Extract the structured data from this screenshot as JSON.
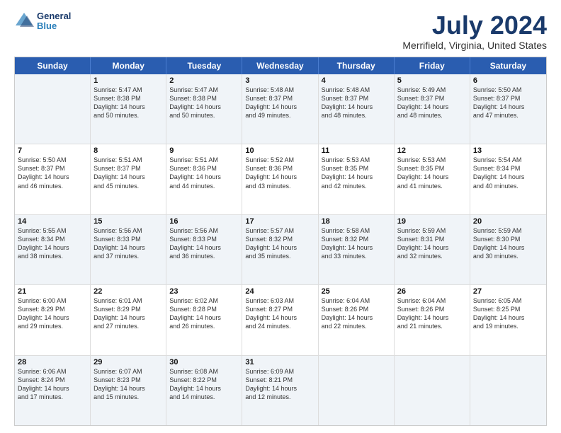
{
  "logo": {
    "line1": "General",
    "line2": "Blue"
  },
  "title": "July 2024",
  "subtitle": "Merrifield, Virginia, United States",
  "days": [
    "Sunday",
    "Monday",
    "Tuesday",
    "Wednesday",
    "Thursday",
    "Friday",
    "Saturday"
  ],
  "rows": [
    [
      {
        "day": "",
        "text": ""
      },
      {
        "day": "1",
        "text": "Sunrise: 5:47 AM\nSunset: 8:38 PM\nDaylight: 14 hours\nand 50 minutes."
      },
      {
        "day": "2",
        "text": "Sunrise: 5:47 AM\nSunset: 8:38 PM\nDaylight: 14 hours\nand 50 minutes."
      },
      {
        "day": "3",
        "text": "Sunrise: 5:48 AM\nSunset: 8:37 PM\nDaylight: 14 hours\nand 49 minutes."
      },
      {
        "day": "4",
        "text": "Sunrise: 5:48 AM\nSunset: 8:37 PM\nDaylight: 14 hours\nand 48 minutes."
      },
      {
        "day": "5",
        "text": "Sunrise: 5:49 AM\nSunset: 8:37 PM\nDaylight: 14 hours\nand 48 minutes."
      },
      {
        "day": "6",
        "text": "Sunrise: 5:50 AM\nSunset: 8:37 PM\nDaylight: 14 hours\nand 47 minutes."
      }
    ],
    [
      {
        "day": "7",
        "text": "Sunrise: 5:50 AM\nSunset: 8:37 PM\nDaylight: 14 hours\nand 46 minutes."
      },
      {
        "day": "8",
        "text": "Sunrise: 5:51 AM\nSunset: 8:37 PM\nDaylight: 14 hours\nand 45 minutes."
      },
      {
        "day": "9",
        "text": "Sunrise: 5:51 AM\nSunset: 8:36 PM\nDaylight: 14 hours\nand 44 minutes."
      },
      {
        "day": "10",
        "text": "Sunrise: 5:52 AM\nSunset: 8:36 PM\nDaylight: 14 hours\nand 43 minutes."
      },
      {
        "day": "11",
        "text": "Sunrise: 5:53 AM\nSunset: 8:35 PM\nDaylight: 14 hours\nand 42 minutes."
      },
      {
        "day": "12",
        "text": "Sunrise: 5:53 AM\nSunset: 8:35 PM\nDaylight: 14 hours\nand 41 minutes."
      },
      {
        "day": "13",
        "text": "Sunrise: 5:54 AM\nSunset: 8:34 PM\nDaylight: 14 hours\nand 40 minutes."
      }
    ],
    [
      {
        "day": "14",
        "text": "Sunrise: 5:55 AM\nSunset: 8:34 PM\nDaylight: 14 hours\nand 38 minutes."
      },
      {
        "day": "15",
        "text": "Sunrise: 5:56 AM\nSunset: 8:33 PM\nDaylight: 14 hours\nand 37 minutes."
      },
      {
        "day": "16",
        "text": "Sunrise: 5:56 AM\nSunset: 8:33 PM\nDaylight: 14 hours\nand 36 minutes."
      },
      {
        "day": "17",
        "text": "Sunrise: 5:57 AM\nSunset: 8:32 PM\nDaylight: 14 hours\nand 35 minutes."
      },
      {
        "day": "18",
        "text": "Sunrise: 5:58 AM\nSunset: 8:32 PM\nDaylight: 14 hours\nand 33 minutes."
      },
      {
        "day": "19",
        "text": "Sunrise: 5:59 AM\nSunset: 8:31 PM\nDaylight: 14 hours\nand 32 minutes."
      },
      {
        "day": "20",
        "text": "Sunrise: 5:59 AM\nSunset: 8:30 PM\nDaylight: 14 hours\nand 30 minutes."
      }
    ],
    [
      {
        "day": "21",
        "text": "Sunrise: 6:00 AM\nSunset: 8:29 PM\nDaylight: 14 hours\nand 29 minutes."
      },
      {
        "day": "22",
        "text": "Sunrise: 6:01 AM\nSunset: 8:29 PM\nDaylight: 14 hours\nand 27 minutes."
      },
      {
        "day": "23",
        "text": "Sunrise: 6:02 AM\nSunset: 8:28 PM\nDaylight: 14 hours\nand 26 minutes."
      },
      {
        "day": "24",
        "text": "Sunrise: 6:03 AM\nSunset: 8:27 PM\nDaylight: 14 hours\nand 24 minutes."
      },
      {
        "day": "25",
        "text": "Sunrise: 6:04 AM\nSunset: 8:26 PM\nDaylight: 14 hours\nand 22 minutes."
      },
      {
        "day": "26",
        "text": "Sunrise: 6:04 AM\nSunset: 8:26 PM\nDaylight: 14 hours\nand 21 minutes."
      },
      {
        "day": "27",
        "text": "Sunrise: 6:05 AM\nSunset: 8:25 PM\nDaylight: 14 hours\nand 19 minutes."
      }
    ],
    [
      {
        "day": "28",
        "text": "Sunrise: 6:06 AM\nSunset: 8:24 PM\nDaylight: 14 hours\nand 17 minutes."
      },
      {
        "day": "29",
        "text": "Sunrise: 6:07 AM\nSunset: 8:23 PM\nDaylight: 14 hours\nand 15 minutes."
      },
      {
        "day": "30",
        "text": "Sunrise: 6:08 AM\nSunset: 8:22 PM\nDaylight: 14 hours\nand 14 minutes."
      },
      {
        "day": "31",
        "text": "Sunrise: 6:09 AM\nSunset: 8:21 PM\nDaylight: 14 hours\nand 12 minutes."
      },
      {
        "day": "",
        "text": ""
      },
      {
        "day": "",
        "text": ""
      },
      {
        "day": "",
        "text": ""
      }
    ]
  ],
  "alt_rows": [
    0,
    2,
    4
  ]
}
